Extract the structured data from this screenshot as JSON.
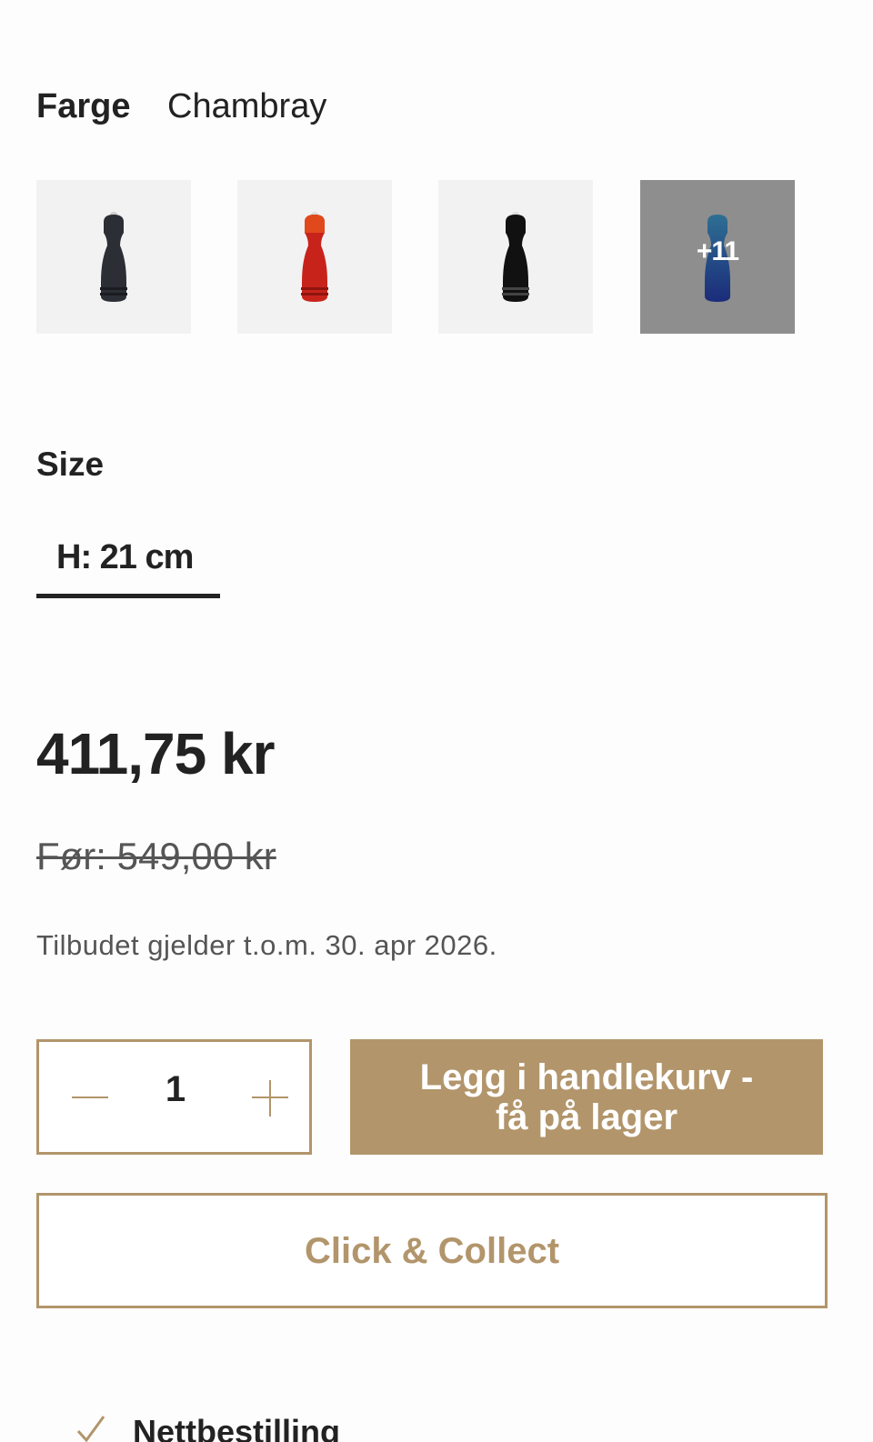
{
  "color": {
    "label": "Farge",
    "value": "Chambray",
    "swatches": [
      {
        "name": "black-matte",
        "color": "#2b2e35"
      },
      {
        "name": "red",
        "color": "#c8231a"
      },
      {
        "name": "black-gloss",
        "color": "#111111"
      },
      {
        "name": "chambray",
        "color": "#2f5b9a"
      }
    ],
    "more_count": "+11"
  },
  "size": {
    "label": "Size",
    "selected": "H: 21 cm"
  },
  "price": {
    "current": "411,75 kr",
    "previous": "Før: 549,00 kr",
    "offer_note": "Tilbudet gjelder t.o.m. 30. apr 2026."
  },
  "cart": {
    "quantity": "1",
    "add_line1": "Legg i handlekurv -",
    "add_line2": "få på lager",
    "click_collect": "Click & Collect"
  },
  "footer_partial": {
    "text": "Nettbestilling",
    "icon": "check-icon"
  },
  "colors": {
    "accent": "#b2956b",
    "text": "#222222",
    "muted": "#555555"
  }
}
